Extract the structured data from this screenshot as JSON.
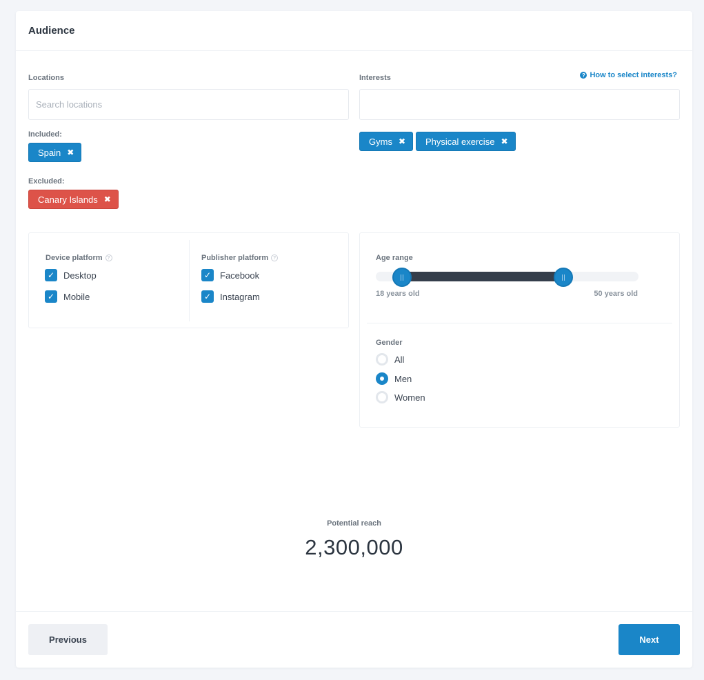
{
  "header": {
    "title": "Audience"
  },
  "locations": {
    "label": "Locations",
    "placeholder": "Search locations",
    "included_label": "Included:",
    "included": [
      "Spain"
    ],
    "excluded_label": "Excluded:",
    "excluded": [
      "Canary Islands"
    ]
  },
  "interests": {
    "label": "Interests",
    "help_link": "How to select interests?",
    "value": "",
    "tags": [
      "Gyms",
      "Physical exercise"
    ]
  },
  "device_platform": {
    "label": "Device platform",
    "options": [
      {
        "label": "Desktop",
        "checked": true
      },
      {
        "label": "Mobile",
        "checked": true
      }
    ]
  },
  "publisher_platform": {
    "label": "Publisher platform",
    "options": [
      {
        "label": "Facebook",
        "checked": true
      },
      {
        "label": "Instagram",
        "checked": true
      }
    ]
  },
  "age_range": {
    "label": "Age range",
    "min_label": "18 years old",
    "max_label": "50 years old",
    "low_fraction": 0.1,
    "high_fraction": 0.715
  },
  "gender": {
    "label": "Gender",
    "options": [
      {
        "label": "All",
        "selected": false
      },
      {
        "label": "Men",
        "selected": true
      },
      {
        "label": "Women",
        "selected": false
      }
    ]
  },
  "reach": {
    "label": "Potential reach",
    "value": "2,300,000"
  },
  "footer": {
    "previous": "Previous",
    "next": "Next"
  },
  "colors": {
    "accent": "#1a86c8",
    "danger": "#dd5349",
    "track_fill": "#353e4b"
  },
  "icons": {
    "remove": "close-icon",
    "help": "question-circle-icon",
    "checkbox": "check-icon"
  }
}
